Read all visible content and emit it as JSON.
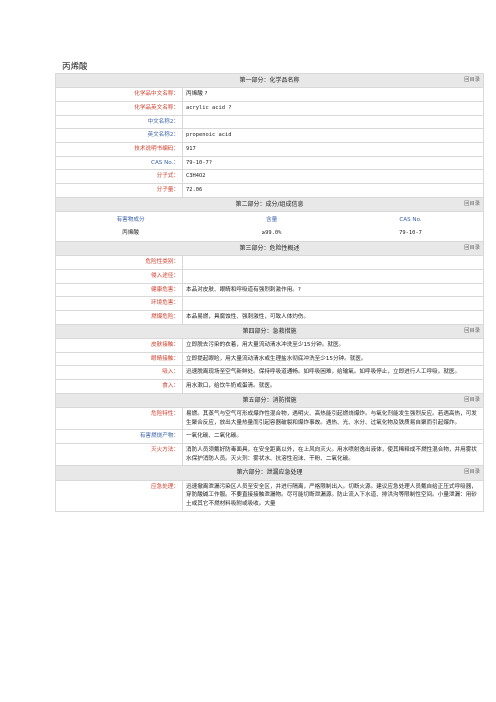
{
  "title": "丙烯酸",
  "back_label": "回目录",
  "section1": {
    "title": "第一部分：化学品名称",
    "rows": [
      {
        "label": "化学品中文名称：",
        "value": "丙烯酸 ?"
      },
      {
        "label": "化学品英文名称：",
        "value": "acrylic acid ?"
      },
      {
        "label": "中文名称2：",
        "value": ""
      },
      {
        "label": "英文名称2：",
        "value": "propenoic acid"
      },
      {
        "label": "技术说明书编码：",
        "value": "917"
      },
      {
        "label": "CAS No.：",
        "value": "79-10-7?"
      },
      {
        "label": "分子式：",
        "value": "C3H4O2"
      },
      {
        "label": "分子量：",
        "value": "72.06"
      }
    ]
  },
  "section2": {
    "title": "第二部分：成分/组成信息",
    "columns": [
      "有害物成分",
      "含量",
      "CAS No."
    ],
    "row": [
      "丙烯酸",
      "≥99.0%",
      "79-10-7"
    ]
  },
  "section3": {
    "title": "第三部分：危险性概述",
    "rows": [
      {
        "label": "危险性类别：",
        "value": ""
      },
      {
        "label": "侵入途径：",
        "value": ""
      },
      {
        "label": "健康危害：",
        "value": "本品对皮肤、眼睛和呼吸道有强烈刺激作用。?"
      },
      {
        "label": "环境危害：",
        "value": ""
      },
      {
        "label": "燃爆危险：",
        "value": "本品易燃，具腐蚀性、强刺激性，可致人体灼伤。"
      }
    ]
  },
  "section4": {
    "title": "第四部分：急救措施",
    "rows": [
      {
        "label": "皮肤接触：",
        "value": "立即脱去污染的衣着，用大量流动清水冲洗至少15分钟。就医。"
      },
      {
        "label": "眼睛接触：",
        "value": "立即提起眼睑，用大量流动清水或生理盐水彻底冲洗至少15分钟。就医。"
      },
      {
        "label": "吸入：",
        "value": "迅速脱离现场至空气新鲜处。保持呼吸道通畅。如呼吸困难，给输氧。如呼吸停止，立即进行人工呼吸。就医。"
      },
      {
        "label": "食入：",
        "value": "用水漱口，给饮牛奶或蛋清。就医。"
      }
    ]
  },
  "section5": {
    "title": "第五部分：消防措施",
    "rows": [
      {
        "label": "危险特性：",
        "value": "易燃。其蒸气与空气可形成爆炸性混合物，遇明火、高热能引起燃烧爆炸。与氧化剂能发生强烈反应。若遇高热，可发生聚合反应，放出大量热量而引起容器破裂和爆炸事故。遇热、光、水分、过氧化物及铁质易自聚而引起爆炸。"
      },
      {
        "label": "有害燃烧产物：",
        "value": "一氧化碳、二氧化碳。"
      },
      {
        "label": "灭火方法：",
        "value": "消防人员须戴好防毒面具，在安全距离以外，在上风向灭火。用水喷射逸出液体，使其稀释成不燃性混合物，并用雾状水保护消防人员。灭火剂：雾状水、抗溶性泡沫、干粉、二氧化碳。"
      }
    ]
  },
  "section6": {
    "title": "第六部分：泄漏应急处理",
    "rows": [
      {
        "label": "应急处理：",
        "value": "迅速撤离泄漏污染区人员至安全区，并进行隔离，严格限制出入。切断火源。建议应急处理人员戴自给正压式呼吸器，穿防酸碱工作服。不要直接接触泄漏物。尽可能切断泄漏源。防止流入下水道、排洪沟等限制性空间。小量泄漏：用砂土或其它不燃材料吸附或吸收。大量"
      }
    ]
  }
}
